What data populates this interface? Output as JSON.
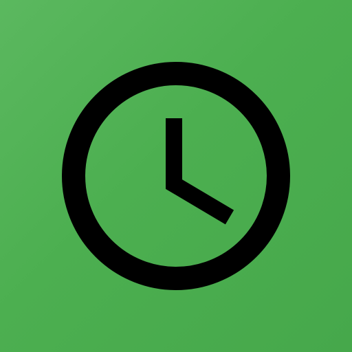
{
  "icon": {
    "name": "clock-icon",
    "background_color": "#4caf50",
    "glyph_color": "#000000"
  }
}
